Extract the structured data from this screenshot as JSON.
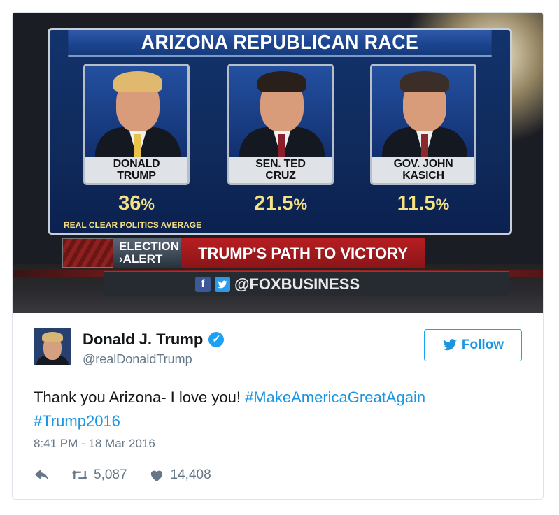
{
  "media": {
    "panel_title": "ARIZONA REPUBLICAN RACE",
    "candidates": [
      {
        "name_line1": "DONALD",
        "name_line2": "TRUMP",
        "pct": "36",
        "pct_sign": "%",
        "hair_color": "#e0b86e",
        "tie_color": "#e8c24a"
      },
      {
        "name_line1": "SEN. TED",
        "name_line2": "CRUZ",
        "pct": "21.5",
        "pct_sign": "%",
        "hair_color": "#2a201b",
        "tie_color": "#8a1e2a"
      },
      {
        "name_line1": "GOV. JOHN",
        "name_line2": "KASICH",
        "pct": "11.5",
        "pct_sign": "%",
        "hair_color": "#3b2e28",
        "tie_color": "#8a2a2e"
      }
    ],
    "source_note": "REAL CLEAR POLITICS AVERAGE",
    "alert_label_line1": "ELECTION",
    "alert_label_line2": "›ALERT",
    "alert_headline": "TRUMP'S PATH TO VICTORY",
    "social_handle": "@FOXBUSINESS",
    "facebook_glyph": "f",
    "twitter_glyph": "t"
  },
  "tweet": {
    "display_name": "Donald J. Trump",
    "handle": "@realDonaldTrump",
    "verified_glyph": "✓",
    "follow_label": "Follow",
    "text_plain": "Thank you Arizona- I love you! ",
    "hashtag1": "#MakeAmericaGreatAgain",
    "hashtag2": "#Trump2016",
    "timestamp": "8:41 PM - 18 Mar 2016",
    "retweets": "5,087",
    "likes": "14,408",
    "accent_color": "#1b95e0"
  }
}
